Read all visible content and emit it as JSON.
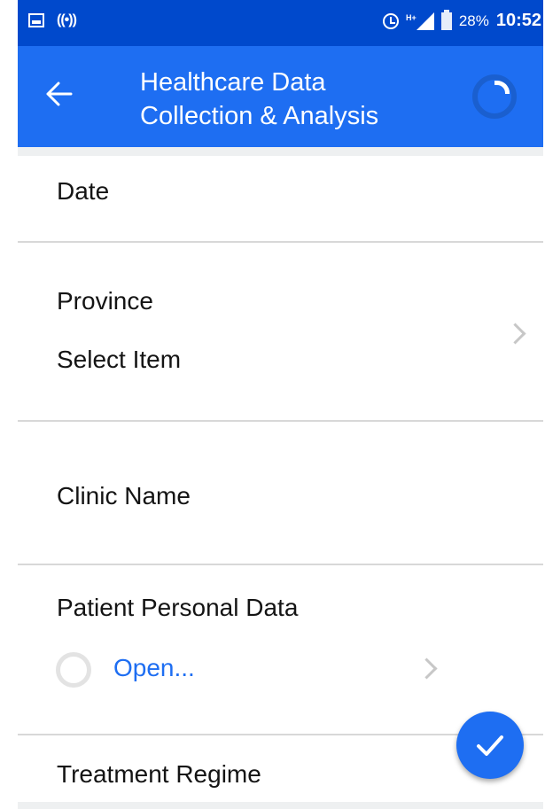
{
  "status_bar": {
    "battery_percent": "28%",
    "time": "10:52",
    "network_type": "H+",
    "icons": [
      "image-icon",
      "cast-icon",
      "alarm-icon",
      "signal-icon",
      "battery-icon"
    ]
  },
  "app_bar": {
    "title_line1": "Healthcare Data",
    "title_line2": "Collection & Analysis",
    "back_icon": "arrow-left-icon",
    "loading_icon": "spinner-icon"
  },
  "form": {
    "date_label": "Date",
    "province_label": "Province",
    "province_value": "Select Item",
    "clinic_label": "Clinic Name",
    "patient_label": "Patient Personal Data",
    "patient_action": "Open...",
    "treatment_label": "Treatment Regime"
  },
  "fab": {
    "icon": "checkmark-icon"
  },
  "colors": {
    "status_bar": "#0049cc",
    "app_bar": "#1e6ef2",
    "link": "#1e6ef2",
    "background": "#eef0f1"
  }
}
